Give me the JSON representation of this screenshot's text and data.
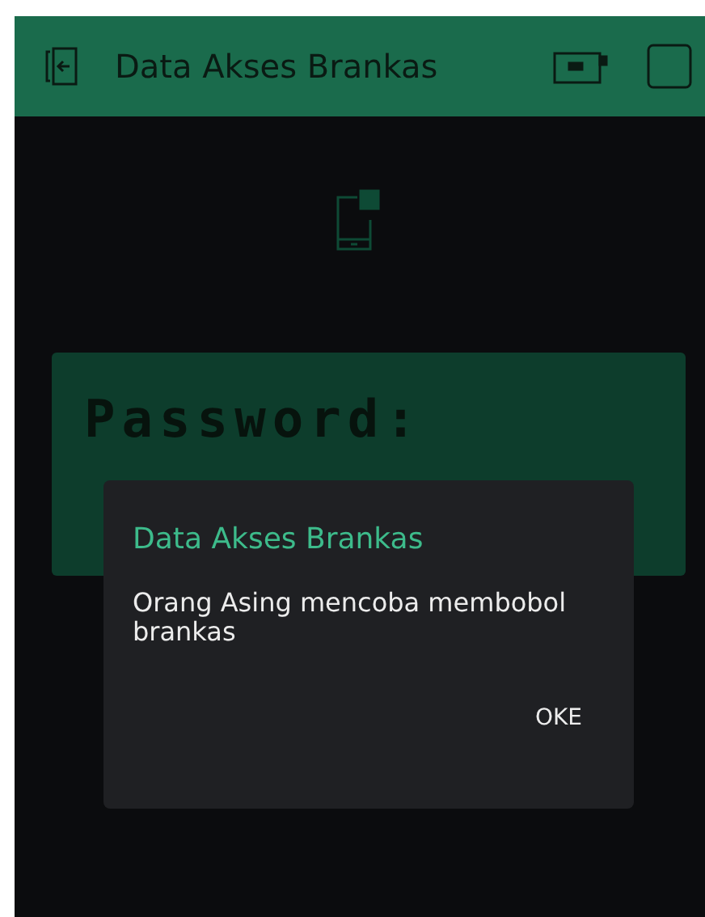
{
  "header": {
    "title": "Data Akses Brankas"
  },
  "lcd": {
    "line_1": "Password:"
  },
  "dialog": {
    "title": "Data Akses Brankas",
    "message": "Orang Asing mencoba membobol brankas",
    "buttons": [
      "OKE"
    ]
  }
}
